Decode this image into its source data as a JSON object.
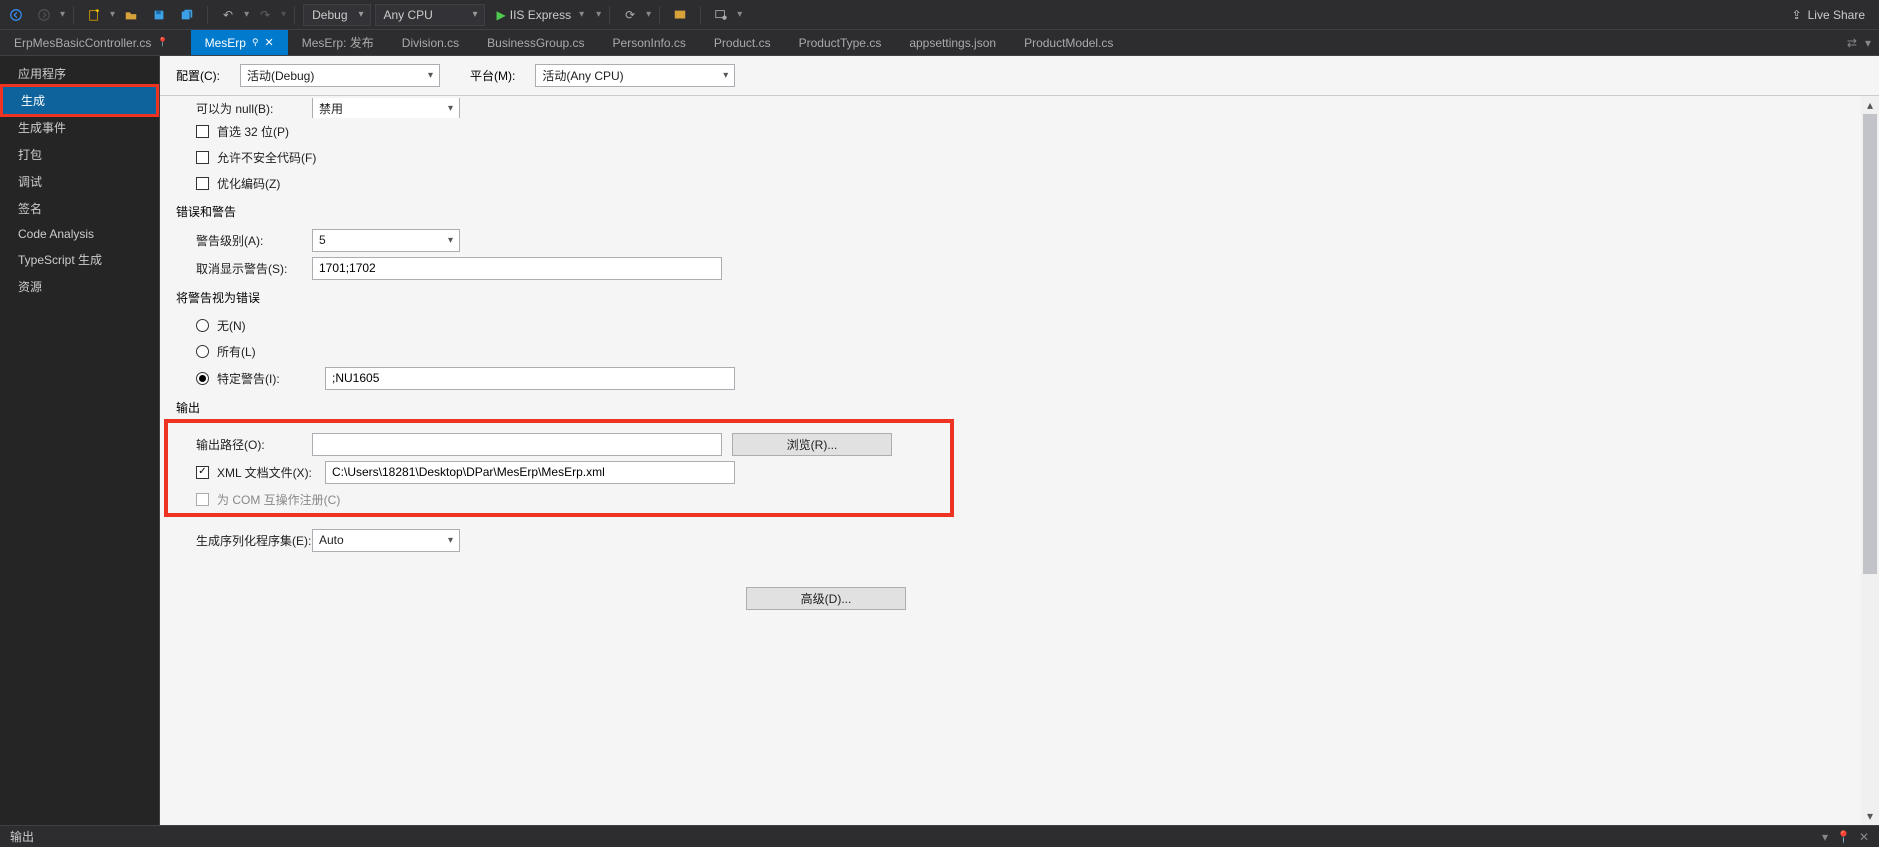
{
  "toolbar": {
    "debug_label": "Debug",
    "anycpu_label": "Any CPU",
    "run_label": "IIS Express",
    "live_share": "Live Share"
  },
  "tabs": [
    {
      "label": "ErpMesBasicController.cs"
    },
    {
      "label": "MesErp"
    },
    {
      "label": "MesErp: 发布"
    },
    {
      "label": "Division.cs"
    },
    {
      "label": "BusinessGroup.cs"
    },
    {
      "label": "PersonInfo.cs"
    },
    {
      "label": "Product.cs"
    },
    {
      "label": "ProductType.cs"
    },
    {
      "label": "appsettings.json"
    },
    {
      "label": "ProductModel.cs"
    }
  ],
  "sidebar": {
    "items": [
      "应用程序",
      "生成",
      "生成事件",
      "打包",
      "调试",
      "签名",
      "Code Analysis",
      "TypeScript 生成",
      "资源"
    ]
  },
  "header": {
    "config_label": "配置(C):",
    "config_value": "活动(Debug)",
    "platform_label": "平台(M):",
    "platform_value": "活动(Any CPU)"
  },
  "general": {
    "nullable_label": "可以为 null(B):",
    "nullable_value": "禁用",
    "prefer32_label": "首选 32 位(P)",
    "unsafe_label": "允许不安全代码(F)",
    "optimize_label": "优化编码(Z)"
  },
  "warnings": {
    "section": "错误和警告",
    "level_label": "警告级别(A):",
    "level_value": "5",
    "suppress_label": "取消显示警告(S):",
    "suppress_value": "1701;1702"
  },
  "treat_as": {
    "section": "将警告视为错误",
    "none": "无(N)",
    "all": "所有(L)",
    "specific": "特定警告(I):",
    "specific_value": ";NU1605"
  },
  "output": {
    "section": "输出",
    "path_label": "输出路径(O):",
    "path_value": "",
    "browse": "浏览(R)...",
    "xml_label": "XML 文档文件(X):",
    "xml_value": "C:\\Users\\18281\\Desktop\\DPar\\MesErp\\MesErp.xml",
    "com_label": "为 COM 互操作注册(C)",
    "serial_label": "生成序列化程序集(E):",
    "serial_value": "Auto",
    "advanced": "高级(D)..."
  },
  "bottom": {
    "output": "输出"
  }
}
